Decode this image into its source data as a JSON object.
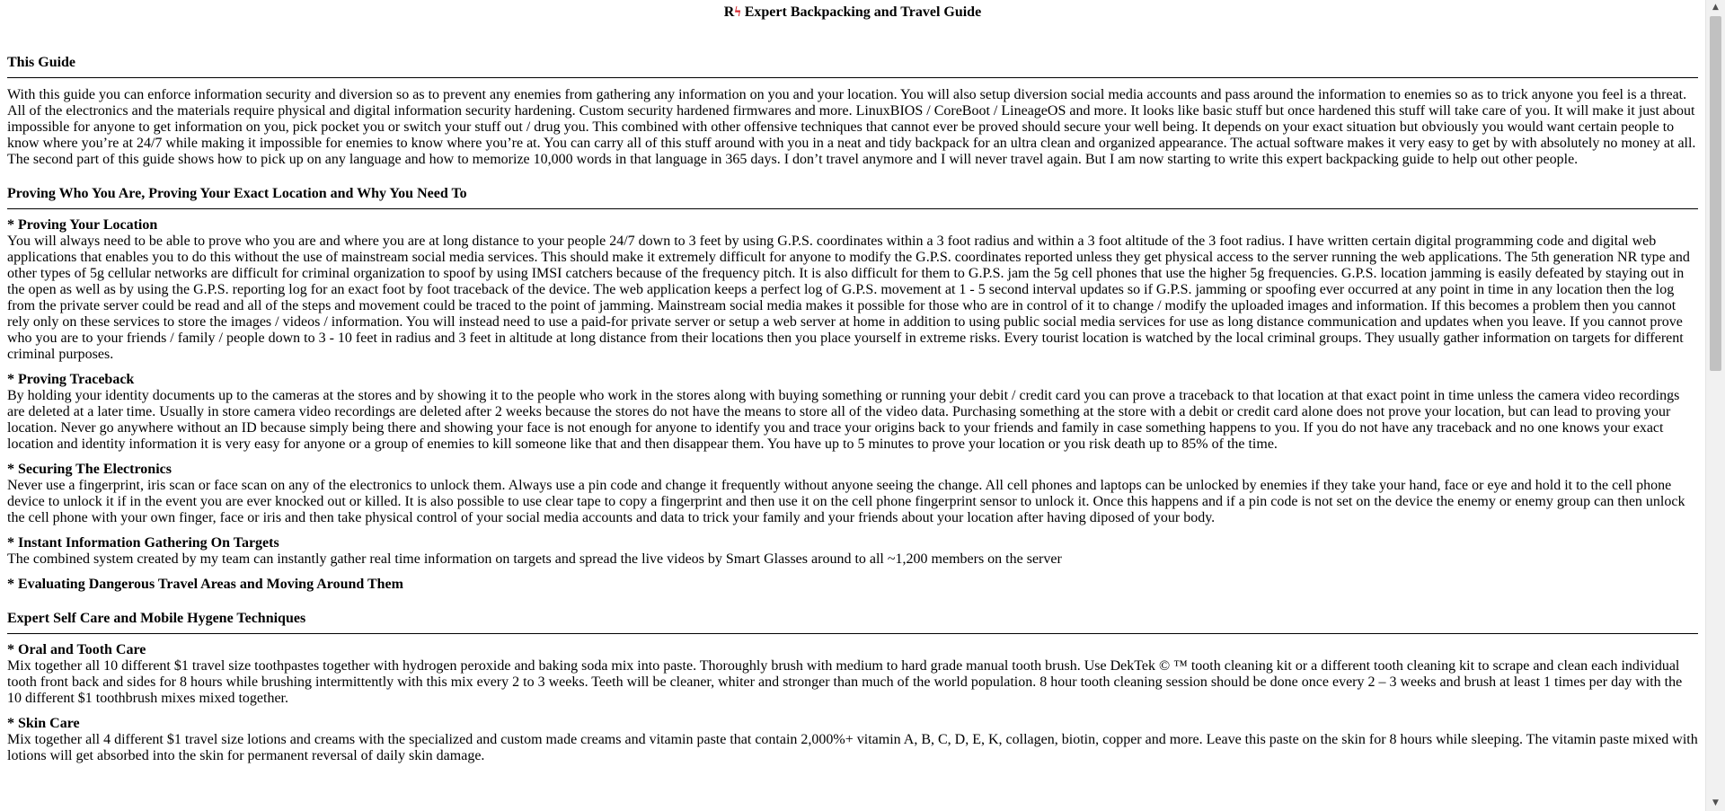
{
  "header": {
    "logo_text": "R",
    "logo_bolt": "ϟ",
    "title": "Expert Backpacking and Travel Guide"
  },
  "sections": {
    "guide": {
      "heading": "This Guide",
      "body": "With this guide you can enforce information security and diversion so as to prevent any enemies from gathering any information on you and your location. You will also setup diversion social media accounts and pass around the information to enemies so as to trick anyone you feel is a threat. All of the electronics and the materials require physical and digital information security hardening. Custom security hardened firmwares and more. LinuxBIOS / CoreBoot / LineageOS and more. It looks like basic stuff but once hardened this stuff will take care of you. It will make it just about impossible for anyone to get information on you, pick pocket you or switch your stuff out / drug you. This combined with other offensive techniques that cannot ever be proved should secure your well being. It depends on your exact situation but obviously you would want certain people to know where you’re at 24/7 while making it impossible for enemies to know where you’re at. You can carry all of this stuff around with you in a neat and tidy backpack for an ultra clean and organized appearance. The actual software makes it very easy to get by with absolutely no money at all. The second part of this guide shows how to pick up on any language and how to memorize 10,000 words in that language in 365 days. I don’t travel anymore and I will never travel again. But I am now starting to write this expert backpacking guide to help out other people."
    },
    "proving": {
      "heading": "Proving Who You Are, Proving Your Exact Location and Why You Need To",
      "items": [
        {
          "title": "* Proving Your Location",
          "body": "You will always need to be able to prove who you are and where you are at long distance to your people 24/7 down to 3 feet by using G.P.S. coordinates within a 3 foot radius and within a 3 foot altitude of the 3 foot radius. I have written certain digital programming code and digital web applications that enables you to do this without the use of mainstream social media services. This should make it extremely difficult for anyone to modify the G.P.S. coordinates reported unless they get physical access to the server running the web applications. The 5th generation NR type and other types of 5g cellular networks are difficult for criminal organization to spoof by using IMSI catchers because of the frequency pitch. It is also difficult for them to G.P.S. jam the 5g cell phones that use the higher 5g frequencies. G.P.S. location jamming is easily defeated by staying out in the open as well as by using the G.P.S. reporting log for an exact foot by foot traceback of the device. The web application keeps a perfect log of G.P.S. movement at 1 - 5 second interval updates so if G.P.S. jamming or spoofing ever occurred at any point in time in any location then the log from the private server could be read and all of the steps and movement could be traced to the point of jamming. Mainstream social media makes it possible for those who are in control of it to change / modify the uploaded images and information. If this becomes a problem then you cannot rely only on these services to store the images / videos / information. You will instead need to use a paid-for private server or setup a web server at home in addition to using public social media services for use as long distance communication and updates when you leave. If you cannot prove who you are to your friends / family / people down to 3 - 10 feet in radius and 3 feet in altitude at long distance from their locations then you place yourself in extreme risks. Every tourist location is watched by the local criminal groups. They usually gather information on targets for different criminal purposes."
        },
        {
          "title": "* Proving Traceback",
          "body": "By holding your identity documents up to the cameras at the stores and by showing it to the people who work in the stores along with buying something or running your debit / credit card you can prove a traceback to that location at that exact point in time unless the camera video recordings are deleted at a later time. Usually in store camera video recordings are deleted after 2 weeks because the stores do not have the means to store all of the video data. Purchasing something at the store with a debit or credit card alone does not prove your location, but can lead to proving your location. Never go anywhere without an ID because simply being there and showing your face is not enough for anyone to identify you and trace your origins back to your friends and family in case something happens to you. If you do not have any traceback and no one knows your exact location and identity information it is very easy for anyone or a group of enemies to kill someone like that and then disappear them. You have up to 5 minutes to prove your location or you risk death up to 85% of the time."
        },
        {
          "title": "* Securing The Electronics",
          "body": "Never use a fingerprint, iris scan or face scan on any of the electronics to unlock them. Always use a pin code and change it frequently without anyone seeing the change. All cell phones and laptops can be unlocked by enemies if they take your hand, face or eye and hold it to the cell phone device to unlock it if in the event you are ever knocked out or killed. It is also possible to use clear tape to copy a fingerprint and then use it on the cell phone fingerprint sensor to unlock it. Once this happens and if a pin code is not set on the device the enemy or enemy group can then unlock the cell phone with your own finger, face or iris and then take physical control of your social media accounts and data to trick your family and your friends about your location after having diposed of your body."
        },
        {
          "title": "* Instant Information Gathering On Targets",
          "body": "The combined system created by my team can instantly gather real time information on targets and spread the live videos by Smart Glasses around to all ~1,200 members on the server"
        },
        {
          "title": "* Evaluating Dangerous Travel Areas and Moving Around Them",
          "body": ""
        }
      ]
    },
    "selfcare": {
      "heading": "Expert Self Care and Mobile Hygene Techniques",
      "items": [
        {
          "title": "* Oral and Tooth Care",
          "body": "Mix together all 10 different $1 travel size toothpastes together with hydrogen peroxide and baking soda mix into paste. Thoroughly brush with medium to hard grade manual tooth brush. Use DekTek © ™ tooth cleaning kit or a different tooth cleaning kit to scrape and clean each individual tooth front back and sides for 8 hours while brushing intermittently with this mix every 2 to 3 weeks. Teeth will be cleaner, whiter and stronger than much of the world population. 8 hour tooth cleaning session should be done once every 2 – 3 weeks and brush at least 1 times per day with the 10 different $1 toothbrush mixes mixed together."
        },
        {
          "title": "* Skin Care",
          "body": "Mix together all 4 different $1 travel size lotions and creams with the specialized and custom made creams and vitamin paste that contain 2,000%+ vitamin A, B, C, D, E, K, collagen, biotin, copper and more. Leave this paste on the skin for 8 hours while sleeping. The vitamin paste mixed with lotions will get absorbed into the skin for permanent reversal of daily skin damage."
        }
      ]
    }
  },
  "scrollbar": {
    "up_glyph": "▲",
    "down_glyph": "▼",
    "position": 0.0
  }
}
